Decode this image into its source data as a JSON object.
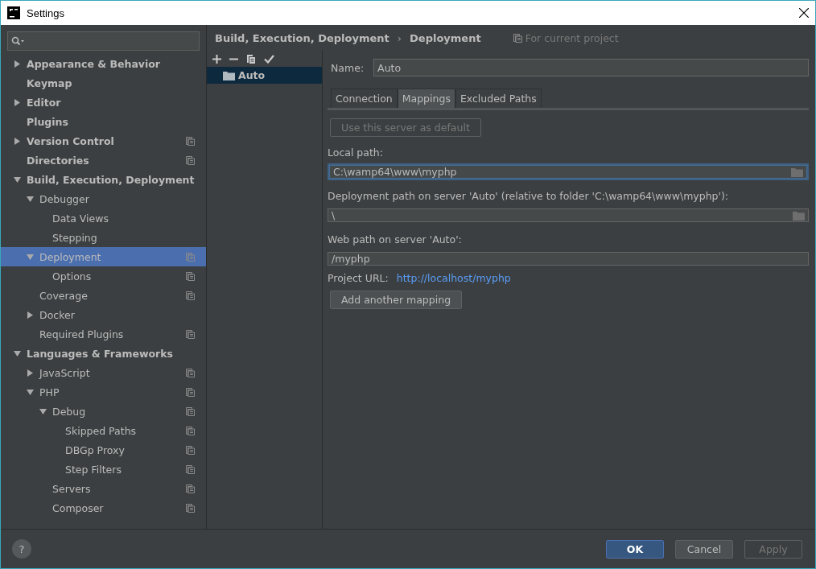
{
  "window": {
    "title": "Settings"
  },
  "sidebar": {
    "tree": [
      {
        "label": "Appearance & Behavior",
        "expanded": false,
        "project": false,
        "selected": false
      },
      {
        "label": "Keymap",
        "project": false,
        "selected": false
      },
      {
        "label": "Editor",
        "expanded": false,
        "project": false,
        "selected": false
      },
      {
        "label": "Plugins",
        "project": false,
        "selected": false
      },
      {
        "label": "Version Control",
        "expanded": false,
        "project": true,
        "selected": false
      },
      {
        "label": "Directories",
        "project": true,
        "selected": false
      },
      {
        "label": "Build, Execution, Deployment",
        "expanded": true,
        "project": false,
        "selected": false,
        "children": [
          {
            "label": "Debugger",
            "expanded": true,
            "project": false,
            "selected": false,
            "children": [
              {
                "label": "Data Views",
                "project": false,
                "selected": false
              },
              {
                "label": "Stepping",
                "project": false,
                "selected": false
              }
            ]
          },
          {
            "label": "Deployment",
            "expanded": true,
            "project": true,
            "selected": true,
            "children": [
              {
                "label": "Options",
                "project": true,
                "selected": false
              }
            ]
          },
          {
            "label": "Coverage",
            "project": true,
            "selected": false
          },
          {
            "label": "Docker",
            "expanded": false,
            "project": false,
            "selected": false
          },
          {
            "label": "Required Plugins",
            "project": true,
            "selected": false
          }
        ]
      },
      {
        "label": "Languages & Frameworks",
        "expanded": true,
        "project": false,
        "selected": false,
        "children": [
          {
            "label": "JavaScript",
            "expanded": false,
            "project": true,
            "selected": false
          },
          {
            "label": "PHP",
            "expanded": true,
            "project": true,
            "selected": false,
            "children": [
              {
                "label": "Debug",
                "expanded": true,
                "project": true,
                "selected": false,
                "children": [
                  {
                    "label": "Skipped Paths",
                    "project": true,
                    "selected": false
                  },
                  {
                    "label": "DBGp Proxy",
                    "project": true,
                    "selected": false
                  },
                  {
                    "label": "Step Filters",
                    "project": true,
                    "selected": false
                  }
                ]
              },
              {
                "label": "Servers",
                "project": true,
                "selected": false
              },
              {
                "label": "Composer",
                "project": true,
                "selected": false
              }
            ]
          }
        ]
      }
    ]
  },
  "breadcrumb": {
    "parent": "Build, Execution, Deployment",
    "separator": "›",
    "current": "Deployment",
    "scope": "For current project"
  },
  "servers": [
    {
      "label": "Auto",
      "selected": true
    }
  ],
  "name_field": {
    "label": "Name:",
    "value": "Auto"
  },
  "tabs": [
    {
      "label": "Connection",
      "selected": false
    },
    {
      "label": "Mappings",
      "selected": true
    },
    {
      "label": "Excluded Paths",
      "selected": false
    }
  ],
  "default_button": {
    "label": "Use this server as default",
    "disabled": true
  },
  "fields": [
    {
      "label": "Local path:",
      "value": "C:\\wamp64\\www\\myphp",
      "focused": true,
      "browse": true
    },
    {
      "label": "Deployment path on server 'Auto' (relative to folder 'C:\\wamp64\\www\\myphp'):",
      "value": "\\",
      "focused": false,
      "browse": true
    },
    {
      "label": "Web path on server 'Auto':",
      "value": "/myphp",
      "focused": false,
      "browse": false
    }
  ],
  "project_url": {
    "label": "Project URL:",
    "link": "http://localhost/myphp"
  },
  "add_mapping_button": "Add another mapping",
  "buttons": [
    {
      "label": "OK",
      "kind": "primary",
      "disabled": false
    },
    {
      "label": "Cancel",
      "kind": "normal",
      "disabled": false
    },
    {
      "label": "Apply",
      "kind": "normal",
      "disabled": true
    }
  ],
  "help": "?"
}
